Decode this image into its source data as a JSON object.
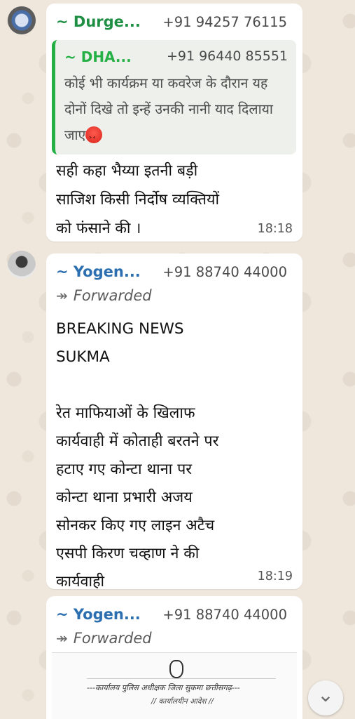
{
  "messages": [
    {
      "sender_name": "~ Durge...",
      "sender_phone": "+91 94257 76115",
      "quoted": {
        "sender_name": "~ DHA...",
        "sender_phone": "+91 96440 85551",
        "text": "कोई भी कार्यक्रम या कवरेज के दौरान यह दोनों दिखे तो इन्हें उनकी नानी याद दिलाया जाए",
        "emoji": "angry-face-emoji"
      },
      "text": "सही कहा भैय्या इतनी बड़ी\nसाजिश किसी निर्दोष व्यक्तियों\nको फंसाने की ।",
      "time": "18:18"
    },
    {
      "sender_name": "~ Yogen...",
      "sender_phone": "+91 88740 44000",
      "forwarded_label": "Forwarded",
      "text": "BREAKING NEWS\nSUKMA\n\nरेत माफियाओं के खिलाफ\nकार्यवाही में कोताही बरतने पर\nहटाए गए कोन्टा थाना पर\nकोन्टा थाना प्रभारी अजय\nसोनकर किए गए लाइन अटैच\nएसपी किरण चव्हाण ने की\nकार्यवाही",
      "time": "18:19"
    },
    {
      "sender_name": "~ Yogen...",
      "sender_phone": "+91 88740 44000",
      "forwarded_label": "Forwarded",
      "document": {
        "line1": "---कार्यालय पुलिस अधीक्षक जिला सुकमा छत्तीसगढ़---",
        "line2": "// कार्यालयीन आदेश //"
      }
    }
  ],
  "icons": {
    "forwarded": "forwarded-arrow-icon",
    "scroll_down": "double-chevron-down-icon"
  },
  "colors": {
    "sender1": "#1f8f44",
    "sender2": "#2b6fb0",
    "quote_accent": "#25b046",
    "bubble": "#ffffff",
    "background": "#efe7dc"
  }
}
